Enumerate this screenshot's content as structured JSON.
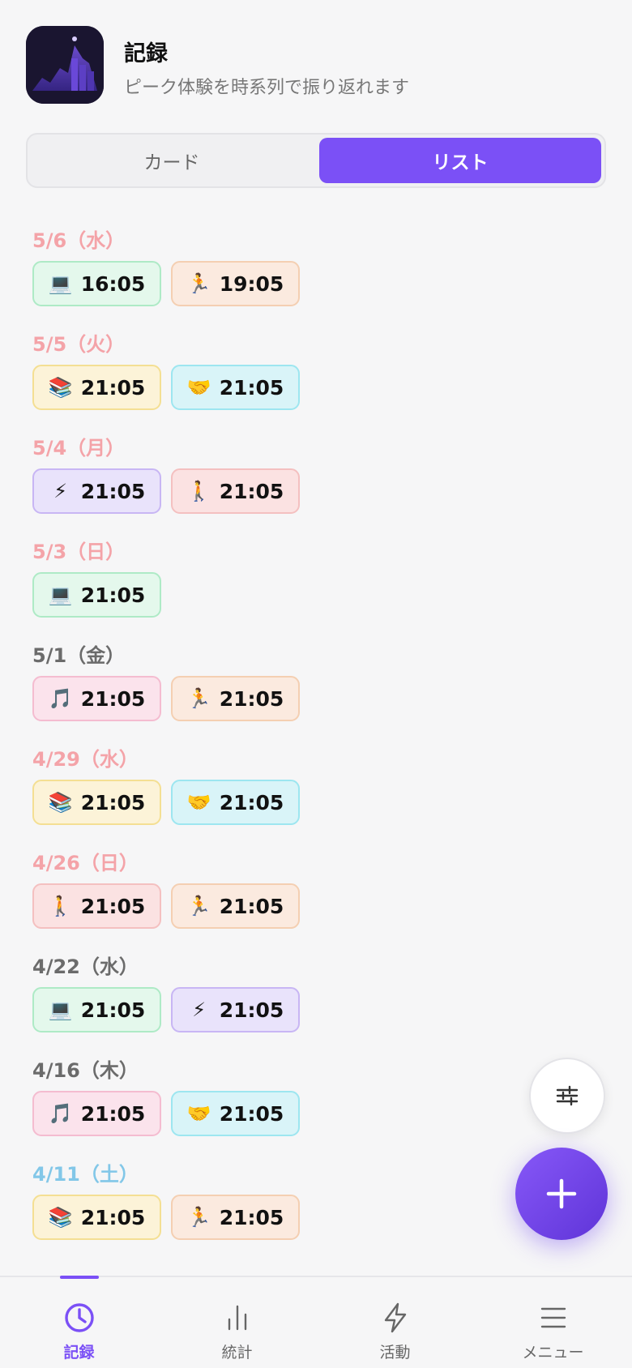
{
  "header": {
    "title": "記録",
    "subtitle": "ピーク体験を時系列で振り返れます"
  },
  "view_toggle": {
    "card_label": "カード",
    "list_label": "リスト",
    "selected": "リスト"
  },
  "category_styles": {
    "laptop": {
      "emoji": "💻",
      "bg": "#e4f8ec",
      "border": "#aeeac6"
    },
    "run": {
      "emoji": "🏃",
      "bg": "#fbeadf",
      "border": "#f4cfb2"
    },
    "books": {
      "emoji": "📚",
      "bg": "#fcf3d8",
      "border": "#f4df93"
    },
    "handshake": {
      "emoji": "🤝",
      "bg": "#d9f4f8",
      "border": "#9de6f0"
    },
    "zap": {
      "emoji": "⚡",
      "bg": "#e9e3fb",
      "border": "#c8b6f4"
    },
    "walk": {
      "emoji": "🚶",
      "bg": "#fbe2e2",
      "border": "#f4c0c0"
    },
    "music": {
      "emoji": "🎵",
      "bg": "#fbe3ec",
      "border": "#f4bcd0"
    }
  },
  "label_colors": {
    "red": "#f4a3a8",
    "gray": "#6b6b6b",
    "blue": "#82c7e8"
  },
  "days": [
    {
      "label": "5/6（水）",
      "color": "red",
      "entries": [
        {
          "cat": "laptop",
          "time": "16:05"
        },
        {
          "cat": "run",
          "time": "19:05"
        }
      ]
    },
    {
      "label": "5/5（火）",
      "color": "red",
      "entries": [
        {
          "cat": "books",
          "time": "21:05"
        },
        {
          "cat": "handshake",
          "time": "21:05"
        }
      ]
    },
    {
      "label": "5/4（月）",
      "color": "red",
      "entries": [
        {
          "cat": "zap",
          "time": "21:05"
        },
        {
          "cat": "walk",
          "time": "21:05"
        }
      ]
    },
    {
      "label": "5/3（日）",
      "color": "red",
      "entries": [
        {
          "cat": "laptop",
          "time": "21:05"
        }
      ]
    },
    {
      "label": "5/1（金）",
      "color": "gray",
      "entries": [
        {
          "cat": "music",
          "time": "21:05"
        },
        {
          "cat": "run",
          "time": "21:05"
        }
      ]
    },
    {
      "label": "4/29（水）",
      "color": "red",
      "entries": [
        {
          "cat": "books",
          "time": "21:05"
        },
        {
          "cat": "handshake",
          "time": "21:05"
        }
      ]
    },
    {
      "label": "4/26（日）",
      "color": "red",
      "entries": [
        {
          "cat": "walk",
          "time": "21:05"
        },
        {
          "cat": "run",
          "time": "21:05"
        }
      ]
    },
    {
      "label": "4/22（水）",
      "color": "gray",
      "entries": [
        {
          "cat": "laptop",
          "time": "21:05"
        },
        {
          "cat": "zap",
          "time": "21:05"
        }
      ]
    },
    {
      "label": "4/16（木）",
      "color": "gray",
      "entries": [
        {
          "cat": "music",
          "time": "21:05"
        },
        {
          "cat": "handshake",
          "time": "21:05"
        }
      ]
    },
    {
      "label": "4/11（土）",
      "color": "blue",
      "entries": [
        {
          "cat": "books",
          "time": "21:05"
        },
        {
          "cat": "run",
          "time": "21:05"
        }
      ]
    }
  ],
  "bottom_nav": [
    {
      "label": "記録",
      "icon": "clock-icon",
      "active": true
    },
    {
      "label": "統計",
      "icon": "bar-chart-icon",
      "active": false
    },
    {
      "label": "活動",
      "icon": "lightning-icon",
      "active": false
    },
    {
      "label": "メニュー",
      "icon": "menu-icon",
      "active": false
    }
  ],
  "accent_color": "#7b50f6"
}
